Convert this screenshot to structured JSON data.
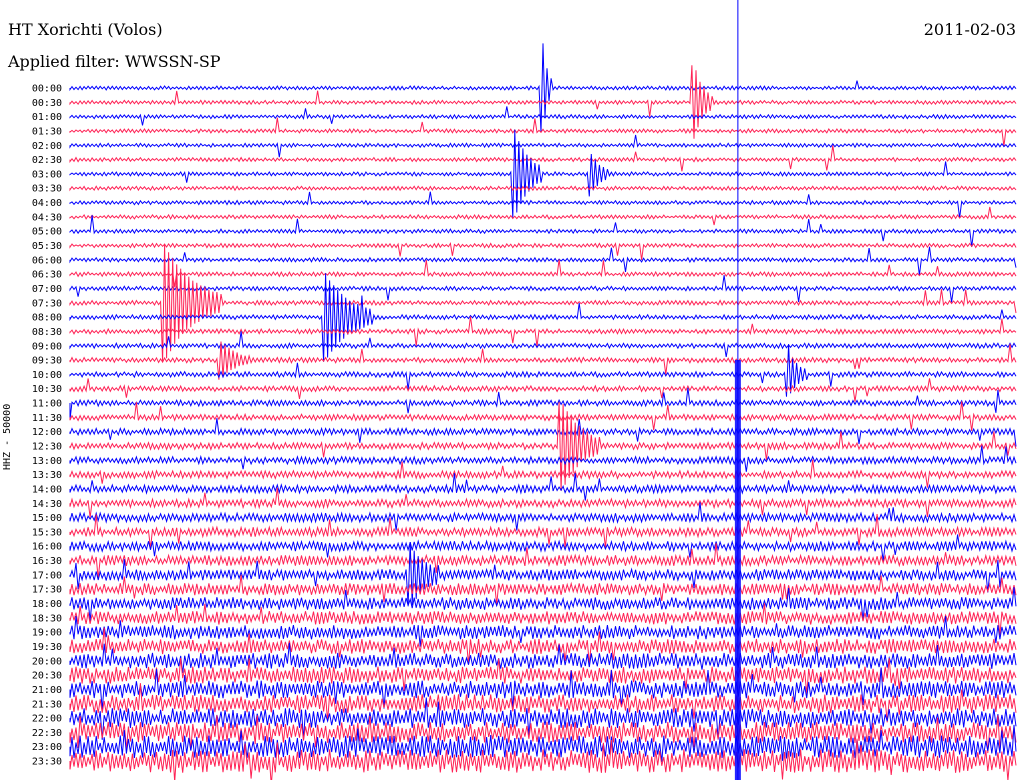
{
  "header": {
    "title": "HT Xorichti (Volos)",
    "date": "2011-02-03",
    "filter": "Applied filter: WWSSN-SP"
  },
  "chart_data": {
    "type": "line",
    "title": "HT Xorichti (Volos)",
    "ylabel": "HHZ - 50000",
    "colors": [
      "#0000ff",
      "#ff2255"
    ],
    "time_labels": [
      "00:00",
      "00:30",
      "01:00",
      "01:30",
      "02:00",
      "02:30",
      "03:00",
      "03:30",
      "04:00",
      "04:30",
      "05:00",
      "05:30",
      "06:00",
      "06:30",
      "07:00",
      "07:30",
      "08:00",
      "08:30",
      "09:00",
      "09:30",
      "10:00",
      "10:30",
      "11:00",
      "11:30",
      "12:00",
      "12:30",
      "13:00",
      "13:30",
      "14:00",
      "14:30",
      "15:00",
      "15:30",
      "16:00",
      "16:30",
      "17:00",
      "17:30",
      "18:00",
      "18:30",
      "19:00",
      "19:30",
      "20:00",
      "20:30",
      "21:00",
      "21:30",
      "22:00",
      "22:30",
      "23:00",
      "23:30"
    ],
    "events": [
      {
        "row": 0,
        "pos": 0.5,
        "amp": 3,
        "dur": 0.01
      },
      {
        "row": 1,
        "pos": 0.66,
        "amp": 2.5,
        "dur": 0.02
      },
      {
        "row": 6,
        "pos": 0.47,
        "amp": 3,
        "dur": 0.03
      },
      {
        "row": 6,
        "pos": 0.55,
        "amp": 1.5,
        "dur": 0.02
      },
      {
        "row": 15,
        "pos": 0.1,
        "amp": 4,
        "dur": 0.06
      },
      {
        "row": 16,
        "pos": 0.27,
        "amp": 3,
        "dur": 0.05
      },
      {
        "row": 19,
        "pos": 0.16,
        "amp": 1.2,
        "dur": 0.03
      },
      {
        "row": 20,
        "pos": 0.76,
        "amp": 1.5,
        "dur": 0.02
      },
      {
        "row": 25,
        "pos": 0.52,
        "amp": 3,
        "dur": 0.04
      },
      {
        "row": 34,
        "pos": 0.36,
        "amp": 2,
        "dur": 0.03
      }
    ],
    "marker_pos": 0.706
  }
}
